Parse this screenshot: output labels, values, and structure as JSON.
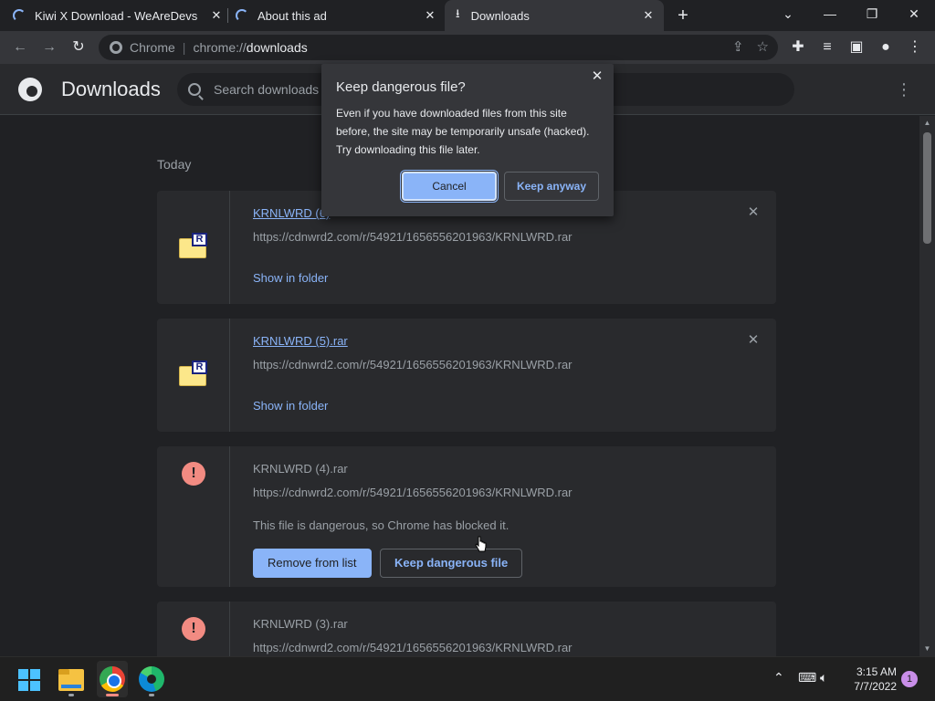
{
  "tabs": [
    {
      "title": "Kiwi X Download - WeAreDevs",
      "loading": true
    },
    {
      "title": "About this ad",
      "loading": true
    },
    {
      "title": "Downloads",
      "active": true
    }
  ],
  "window": {
    "minimize": "—",
    "restore": "❐",
    "close": "✕",
    "dropdown": "⌄"
  },
  "omnibox": {
    "label": "Chrome",
    "scheme": "chrome://",
    "host": "downloads"
  },
  "header": {
    "title": "Downloads",
    "search_placeholder": "Search downloads"
  },
  "section": {
    "date": "Today"
  },
  "downloads": [
    {
      "name": "KRNLWRD (6)",
      "url": "https://cdnwrd2.com/r/54921/1656556201963/KRNLWRD.rar",
      "action": "Show in folder"
    },
    {
      "name": "KRNLWRD (5).rar",
      "url": "https://cdnwrd2.com/r/54921/1656556201963/KRNLWRD.rar",
      "action": "Show in folder"
    },
    {
      "name": "KRNLWRD (4).rar",
      "url": "https://cdnwrd2.com/r/54921/1656556201963/KRNLWRD.rar",
      "warning": "This file is dangerous, so Chrome has blocked it.",
      "remove_label": "Remove from list",
      "keep_label": "Keep dangerous file"
    },
    {
      "name": "KRNLWRD (3).rar",
      "url": "https://cdnwrd2.com/r/54921/1656556201963/KRNLWRD.rar"
    }
  ],
  "dialog": {
    "title": "Keep dangerous file?",
    "body": "Even if you have downloaded files from this site before, the site may be temporarily unsafe (hacked). Try downloading this file later.",
    "cancel": "Cancel",
    "keep": "Keep anyway"
  },
  "taskbar": {
    "time": "3:15 AM",
    "date": "7/7/2022",
    "notifications": "1"
  },
  "colors": {
    "accent": "#8ab4f8",
    "danger": "#f28b82",
    "background": "#202124",
    "card": "#292a2d"
  }
}
